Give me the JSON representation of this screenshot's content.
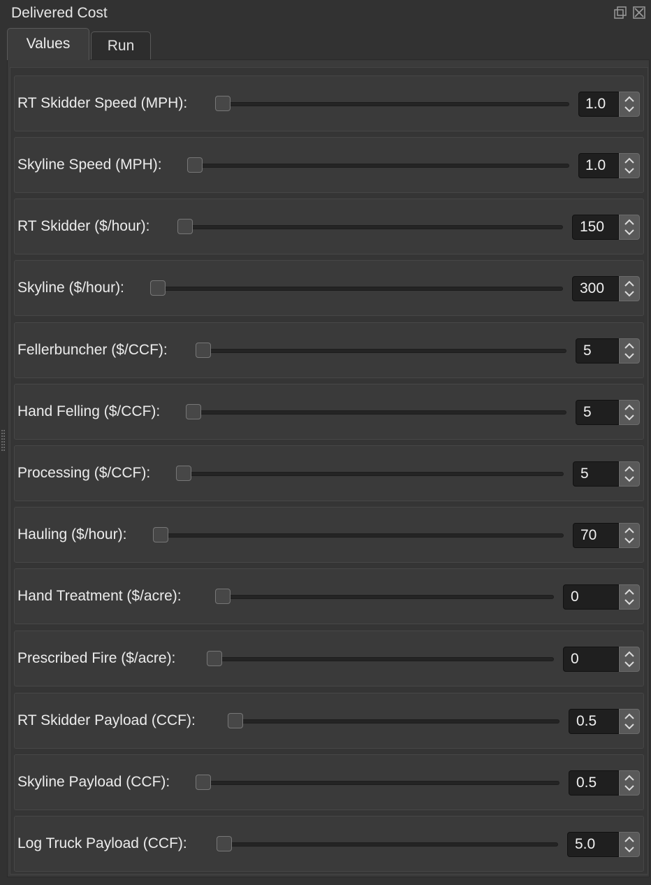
{
  "window": {
    "title": "Delivered Cost",
    "float_icon": "float-window-icon",
    "close_icon": "close-icon"
  },
  "tabs": [
    {
      "label": "Values",
      "active": true
    },
    {
      "label": "Run",
      "active": false
    }
  ],
  "params": [
    {
      "label": "RT Skidder Speed (MPH):",
      "value": "1.0"
    },
    {
      "label": "Skyline Speed (MPH):",
      "value": "1.0"
    },
    {
      "label": "RT Skidder ($/hour):",
      "value": "150"
    },
    {
      "label": "Skyline ($/hour):",
      "value": "300"
    },
    {
      "label": "Fellerbuncher ($/CCF):",
      "value": "5"
    },
    {
      "label": "Hand Felling ($/CCF):",
      "value": "5"
    },
    {
      "label": "Processing ($/CCF):",
      "value": "5"
    },
    {
      "label": "Hauling ($/hour):",
      "value": "70"
    },
    {
      "label": "Hand Treatment ($/acre):",
      "value": "0"
    },
    {
      "label": "Prescribed Fire ($/acre):",
      "value": "0"
    },
    {
      "label": "RT Skidder Payload (CCF):",
      "value": "0.5"
    },
    {
      "label": "Skyline Payload (CCF):",
      "value": "0.5"
    },
    {
      "label": "Log Truck Payload (CCF):",
      "value": "5.0"
    }
  ],
  "colors": {
    "background": "#323232",
    "field": "#1f1f1f",
    "text": "#e6e6e6"
  }
}
